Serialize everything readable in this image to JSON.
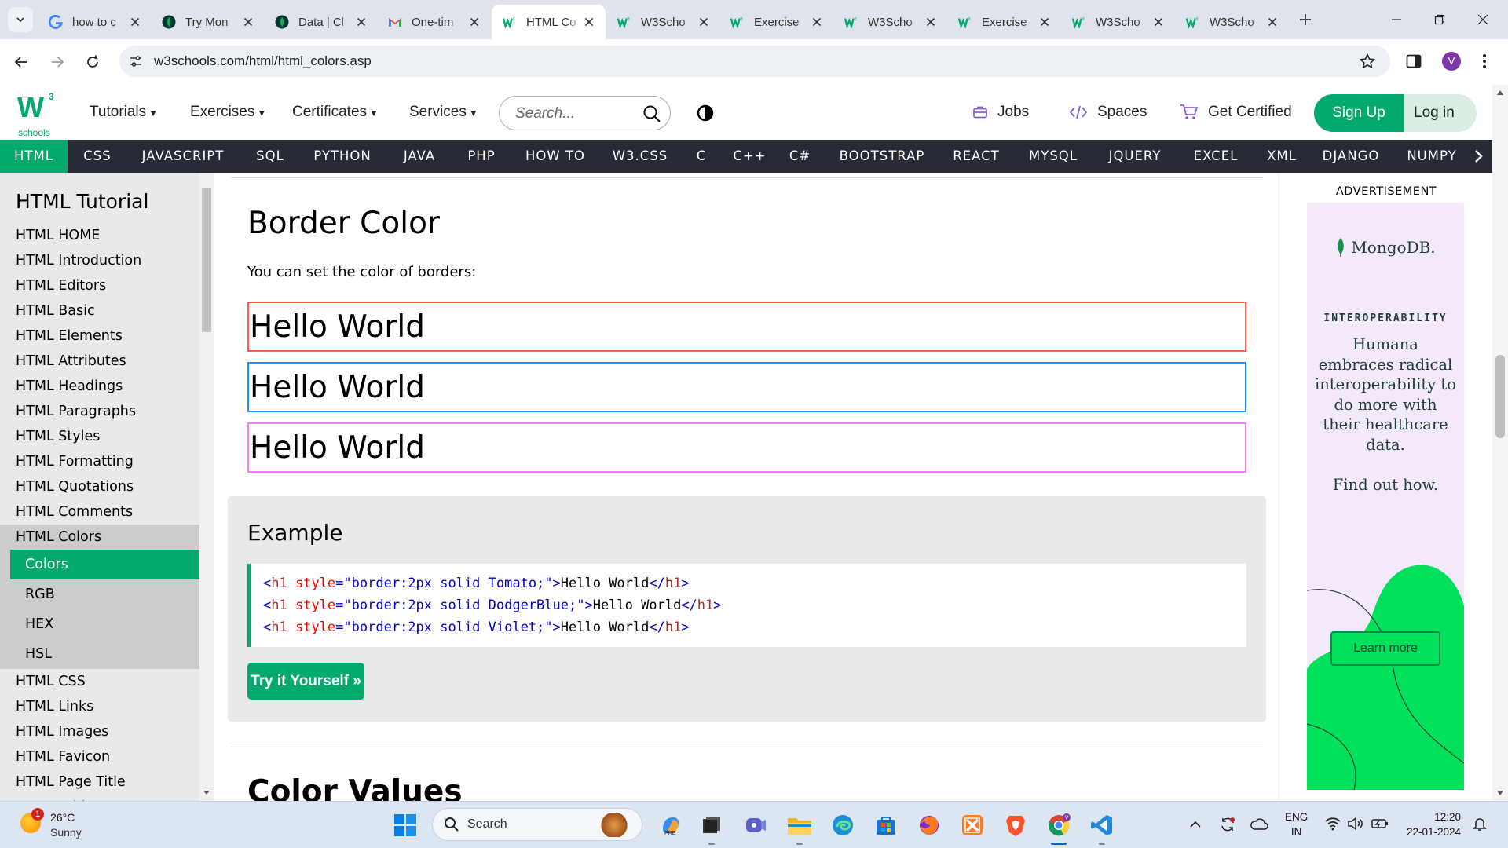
{
  "browser": {
    "tabs": [
      {
        "title": "how to c",
        "icon": "google-icon",
        "active": false
      },
      {
        "title": "Try Mon",
        "icon": "mongodb-icon",
        "active": false
      },
      {
        "title": "Data | Cl",
        "icon": "mongodb-icon",
        "active": false
      },
      {
        "title": "One-tim",
        "icon": "gmail-icon",
        "active": false
      },
      {
        "title": "HTML Co",
        "icon": "w3schools-icon",
        "active": true
      },
      {
        "title": "W3Scho",
        "icon": "w3schools-icon",
        "active": false
      },
      {
        "title": "Exercise",
        "icon": "w3schools-icon",
        "active": false
      },
      {
        "title": "W3Scho",
        "icon": "w3schools-icon",
        "active": false
      },
      {
        "title": "Exercise",
        "icon": "w3schools-icon",
        "active": false
      },
      {
        "title": "W3Scho",
        "icon": "w3schools-icon",
        "active": false
      },
      {
        "title": "W3Scho",
        "icon": "w3schools-icon",
        "active": false
      }
    ],
    "url": "w3schools.com/html/html_colors.asp",
    "profile_initial": "V"
  },
  "w3nav": {
    "logo_sup": "3",
    "logo_text": "schools",
    "menus": [
      "Tutorials",
      "Exercises",
      "Certificates",
      "Services"
    ],
    "search_placeholder": "Search...",
    "jobs": "Jobs",
    "spaces": "Spaces",
    "get_certified": "Get Certified",
    "signup": "Sign Up",
    "login": "Log in"
  },
  "subjects": [
    "HTML",
    "CSS",
    "JAVASCRIPT",
    "SQL",
    "PYTHON",
    "JAVA",
    "PHP",
    "HOW TO",
    "W3.CSS",
    "C",
    "C++",
    "C#",
    "BOOTSTRAP",
    "REACT",
    "MYSQL",
    "JQUERY",
    "EXCEL",
    "XML",
    "DJANGO",
    "NUMPY"
  ],
  "sidebar": {
    "title": "HTML Tutorial",
    "items": [
      "HTML HOME",
      "HTML Introduction",
      "HTML Editors",
      "HTML Basic",
      "HTML Elements",
      "HTML Attributes",
      "HTML Headings",
      "HTML Paragraphs",
      "HTML Styles",
      "HTML Formatting",
      "HTML Quotations",
      "HTML Comments",
      "HTML Colors"
    ],
    "sub_items": [
      "Colors",
      "RGB",
      "HEX",
      "HSL"
    ],
    "items_after": [
      "HTML CSS",
      "HTML Links",
      "HTML Images",
      "HTML Favicon",
      "HTML Page Title",
      "HTML Tables"
    ]
  },
  "main": {
    "heading": "Border Color",
    "intro": "You can set the color of borders:",
    "hello_boxes": [
      {
        "text": "Hello World",
        "color": "#ff6347"
      },
      {
        "text": "Hello World",
        "color": "#1e90ff"
      },
      {
        "text": "Hello World",
        "color": "#ee82ee"
      }
    ],
    "example": {
      "title": "Example",
      "lines": [
        {
          "tag": "h1",
          "attr": "style",
          "val": "\"border:2px solid Tomato;\"",
          "text": "Hello World"
        },
        {
          "tag": "h1",
          "attr": "style",
          "val": "\"border:2px solid DodgerBlue;\"",
          "text": "Hello World"
        },
        {
          "tag": "h1",
          "attr": "style",
          "val": "\"border:2px solid Violet;\"",
          "text": "Hello World"
        }
      ],
      "try_button": "Try it Yourself »"
    },
    "next_heading": "Color Values"
  },
  "ad": {
    "label": "ADVERTISEMENT",
    "brand": "MongoDB.",
    "kicker": "INTEROPERABILITY",
    "copy": "Humana embraces radical interoperability to do more with their healthcare data.",
    "cta": "Find out how.",
    "button": "Learn more"
  },
  "taskbar": {
    "weather_temp": "26°C",
    "weather_cond": "Sunny",
    "weather_badge": "1",
    "search_label": "Search",
    "lang_line1": "ENG",
    "lang_line2": "IN",
    "time": "12:20",
    "date": "22-01-2024"
  },
  "colors": {
    "w3_green": "#04aa6d",
    "subject_bar": "#282a35",
    "sidebar_bg": "#e7e9eb"
  }
}
